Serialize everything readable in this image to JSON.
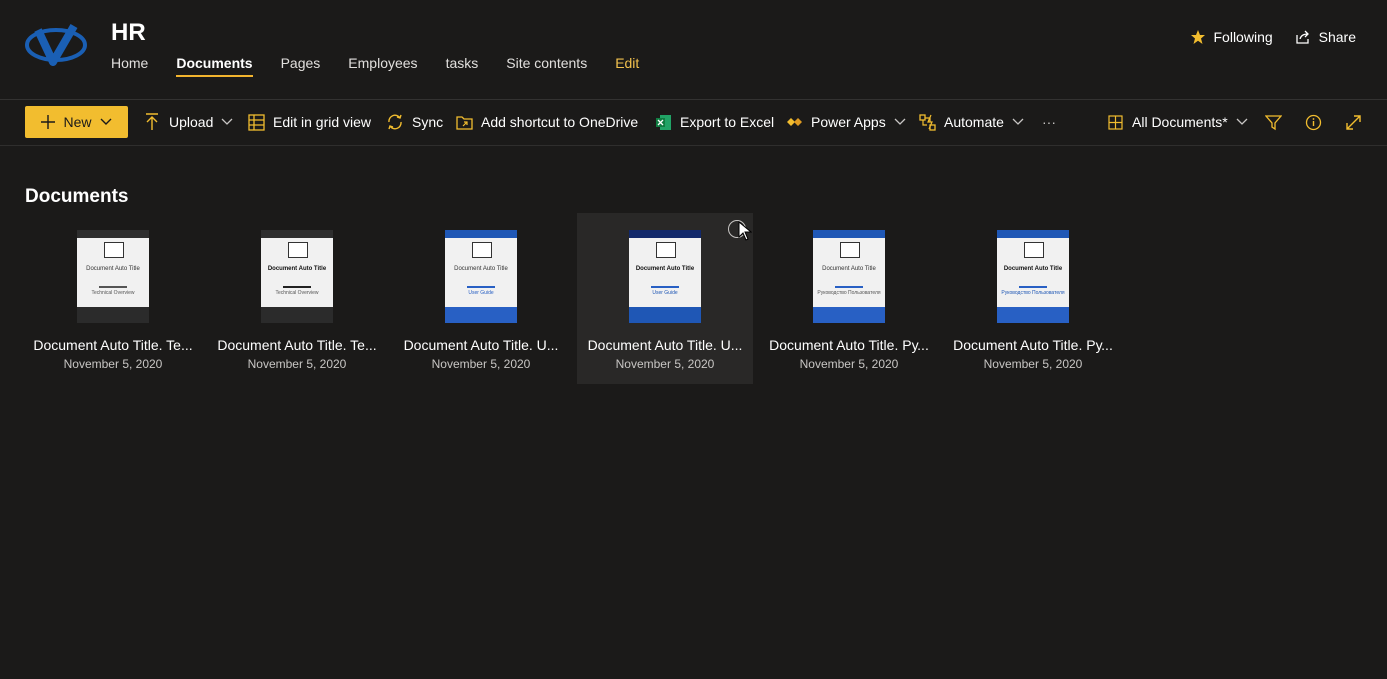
{
  "site": {
    "title": "HR"
  },
  "nav": [
    {
      "label": "Home"
    },
    {
      "label": "Documents"
    },
    {
      "label": "Pages"
    },
    {
      "label": "Employees"
    },
    {
      "label": "tasks"
    },
    {
      "label": "Site contents"
    },
    {
      "label": "Edit"
    }
  ],
  "top_actions": {
    "following": "Following",
    "share": "Share"
  },
  "commands": {
    "new": "New",
    "upload": "Upload",
    "grid": "Edit in grid view",
    "sync": "Sync",
    "shortcut": "Add shortcut to OneDrive",
    "excel": "Export to Excel",
    "powerapps": "Power Apps",
    "automate": "Automate",
    "more": "···",
    "view": "All Documents*"
  },
  "section_title": "Documents",
  "documents": [
    {
      "name": "Document Auto Title. Te...",
      "date": "November 5, 2020",
      "thumb_title": "Document Auto Title",
      "thumb_sub": "Technical Overview"
    },
    {
      "name": "Document Auto Title. Te...",
      "date": "November 5, 2020",
      "thumb_title": "Document Auto Title",
      "thumb_sub": "Technical Overview"
    },
    {
      "name": "Document Auto Title. U...",
      "date": "November 5, 2020",
      "thumb_title": "Document Auto Title",
      "thumb_sub": "User Guide"
    },
    {
      "name": "Document Auto Title. U...",
      "date": "November 5, 2020",
      "thumb_title": "Document Auto Title",
      "thumb_sub": "User Guide"
    },
    {
      "name": "Document Auto Title. Ру...",
      "date": "November 5, 2020",
      "thumb_title": "Document Auto Title",
      "thumb_sub": "Руководство Пользователя"
    },
    {
      "name": "Document Auto Title. Ру...",
      "date": "November 5, 2020",
      "thumb_title": "Document Auto Title",
      "thumb_sub": "Руководство Пользователя"
    }
  ],
  "colors": {
    "accent": "#f2bd2f",
    "background": "#1b1a19",
    "text": "#ffffff"
  }
}
